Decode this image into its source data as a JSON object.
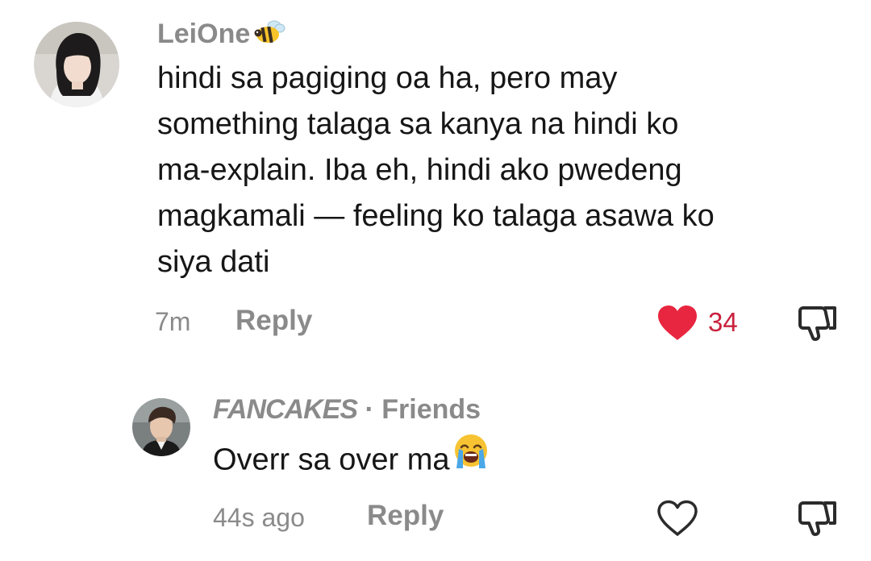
{
  "comments": [
    {
      "username": "LeiOne",
      "username_emoji": "bee-emoji",
      "text_lines": [
        "hindi sa pagiging oa ha, pero may",
        "something talaga sa kanya na hindi ko",
        "ma-explain. Iba eh, hindi ako pwedeng",
        "magkamali — feeling ko talaga asawa ko",
        "siya dati"
      ],
      "timestamp": "7m",
      "reply_label": "Reply",
      "liked": true,
      "like_count": "34",
      "like_color": "#e8263f",
      "count_color": "#c8223e"
    },
    {
      "username": "FANCAKES",
      "relation_separator": "·",
      "relation": "Friends",
      "text": "Overr sa over ma",
      "text_emoji": "loudly-crying-face-emoji",
      "timestamp": "44s ago",
      "reply_label": "Reply",
      "liked": false,
      "like_count": ""
    }
  ],
  "colors": {
    "meta_gray": "#8a8a8a",
    "text_dark": "#161616"
  }
}
